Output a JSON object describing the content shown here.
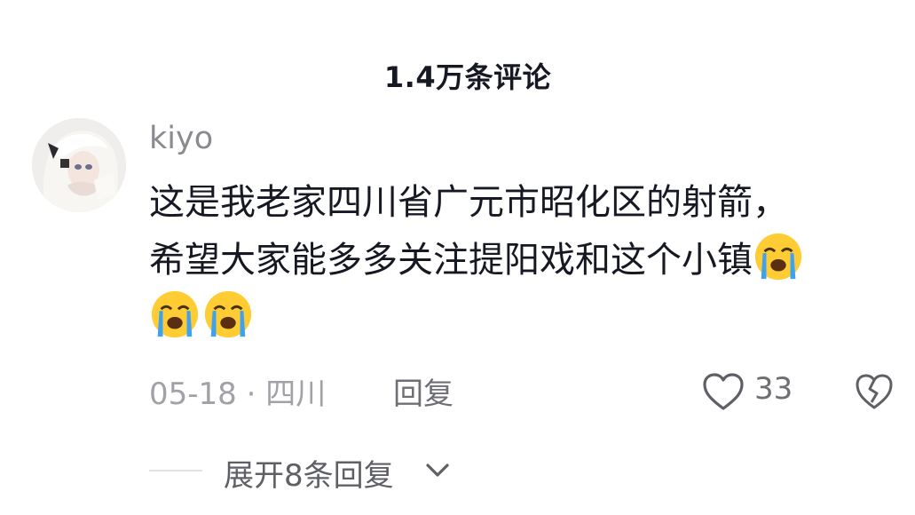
{
  "header": {
    "title": "1.4万条评论"
  },
  "comment": {
    "username": "kiyo",
    "line1": "这是我老家四川省广元市昭化区的射箭，",
    "line2": "希望大家能多多关注提阳戏和这个小镇",
    "emoji_icon": "loudly-crying-face-icon",
    "date": "05-18",
    "separator": "·",
    "location": "四川",
    "reply_label": "回复",
    "like_count": "33"
  },
  "replies": {
    "expand_label": "展开8条回复"
  },
  "colors": {
    "text": "#161823",
    "muted": "#a1a2a7",
    "emoji_face": "#ffcc33"
  }
}
